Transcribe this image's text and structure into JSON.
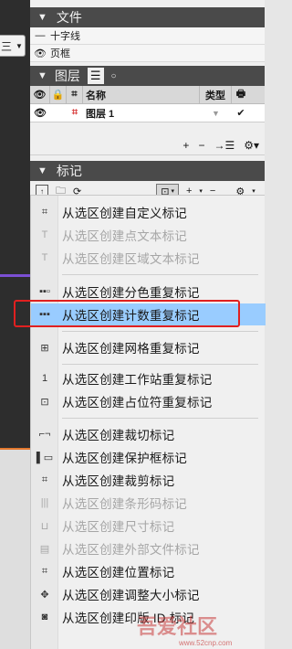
{
  "left": {
    "dropdown_label": "三"
  },
  "files": {
    "header": "文件",
    "items": [
      {
        "icon": "dash",
        "label": "十字线"
      },
      {
        "icon": "eye",
        "label": "页框"
      }
    ]
  },
  "layers": {
    "header": "图层",
    "tab_list": "☰",
    "tab_circle": "○",
    "col_name": "名称",
    "col_type": "类型",
    "layer_name": "图层 1",
    "toolbar": [
      "+",
      "−",
      "→☰",
      "⚙▾"
    ]
  },
  "marks": {
    "header": "标记",
    "toolbar_add": "+",
    "toolbar_minus": "−",
    "toolbar_gear": "⚙"
  },
  "menu": {
    "items": [
      {
        "icon": "⌗",
        "label": "从选区创建自定义标记",
        "enabled": true
      },
      {
        "icon": "T",
        "label": "从选区创建点文本标记",
        "enabled": false
      },
      {
        "icon": "T",
        "label": "从选区创建区域文本标记",
        "enabled": false
      },
      {
        "icon": "▪▪▫",
        "label": "从选区创建分色重复标记",
        "enabled": true
      },
      {
        "icon": "▪▪▪",
        "label": "从选区创建计数重复标记",
        "enabled": true
      },
      {
        "icon": "⊞",
        "label": "从选区创建网格重复标记",
        "enabled": true
      },
      {
        "icon": "1",
        "label": "从选区创建工作站重复标记",
        "enabled": true
      },
      {
        "icon": "⊡",
        "label": "从选区创建占位符重复标记",
        "enabled": true
      },
      {
        "icon": "⌐¬",
        "label": "从选区创建裁切标记",
        "enabled": true
      },
      {
        "icon": "▌▭",
        "label": "从选区创建保护框标记",
        "enabled": true
      },
      {
        "icon": "⌗",
        "label": "从选区创建裁剪标记",
        "enabled": true
      },
      {
        "icon": "|||",
        "label": "从选区创建条形码标记",
        "enabled": false
      },
      {
        "icon": "⊔",
        "label": "从选区创建尺寸标记",
        "enabled": false
      },
      {
        "icon": "▤",
        "label": "从选区创建外部文件标记",
        "enabled": false
      },
      {
        "icon": "⌗",
        "label": "从选区创建位置标记",
        "enabled": true
      },
      {
        "icon": "✥",
        "label": "从选区创建调整大小标记",
        "enabled": true
      },
      {
        "icon": "◙",
        "label": "从选区创建印版 ID 标记",
        "enabled": true
      }
    ]
  },
  "watermark": {
    "main": "吾爱社区",
    "sub": "www.52cnp.com"
  },
  "colors": {
    "header_bg": "#4a4a4a",
    "highlight": "#99ccff",
    "annotation": "#e02020"
  }
}
